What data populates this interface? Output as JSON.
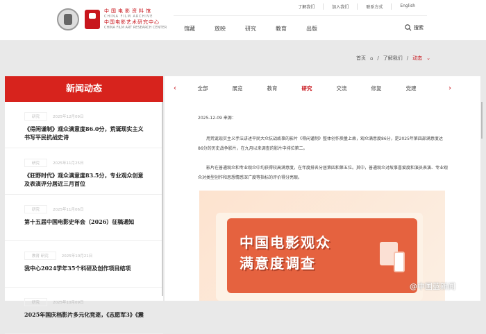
{
  "header": {
    "logo_cn": "中国电影资料馆",
    "logo_en": "CHINA FILM ARCHIVE",
    "logo2_cn": "中国电影艺术研究中心",
    "logo2_en": "CHINA FILM ART RESEARCH CENTER",
    "top_links": [
      "了解我们",
      "加入我们",
      "联系方式",
      "English"
    ],
    "nav": [
      "馆藏",
      "放映",
      "研究",
      "教育",
      "出版"
    ],
    "search_label": "搜索"
  },
  "breadcrumb": {
    "home": "首页",
    "level2": "了解我们",
    "current": "动态"
  },
  "sidebar": {
    "title": "新闻动态",
    "items": [
      {
        "tag": "研究",
        "date": "2025年12月09日",
        "title": "《得闲谨制》观众满意度86.0分，荒诞现实主义书写平民抗战史诗"
      },
      {
        "tag": "研究",
        "date": "2025年11月25日",
        "title": "《狂野时代》观众满意度83.5分，专业观众创意及表演评分居近三月首位"
      },
      {
        "tag": "研究",
        "date": "2025年11月06日",
        "title": "第十五届中国电影史年会（2026）征稿通知"
      },
      {
        "tag": "教育 研究",
        "date": "2025年10月21日",
        "title": "我中心2024学年35个科研及创作项目结项"
      },
      {
        "tag": "研究",
        "date": "2025年10月09日",
        "title": "2025年国庆档影片多元化竞逐，《志愿军3》《震"
      }
    ]
  },
  "tabs": {
    "prev": "‹",
    "next": "›",
    "items": [
      "全部",
      "展览",
      "教育",
      "研究",
      "交流",
      "修复",
      "党建"
    ],
    "active": "研究"
  },
  "article": {
    "meta": "2025-12-09  来源：",
    "p1": "用荒诞现实主义手法讲述平民大众抗战故事的影片《得闲谨制》整体创作质量上乘，观众满意度86分，是2025年第四部满意度达86分的历史战争影片，在九月以来调查的影片中排位第二。",
    "p2": "影片在普通观众和专业观众中均获得较高满意度，在年度排名分居第四和第五位。其中，普通观众对故事喜爱度和演员表演、专业观众对类型创作和思想情感深广度等指标的评价得分亮眼。",
    "banner_line1": "中国电影观众",
    "banner_line2": "满意度调查",
    "watermark": "@中国蓝新闻"
  }
}
